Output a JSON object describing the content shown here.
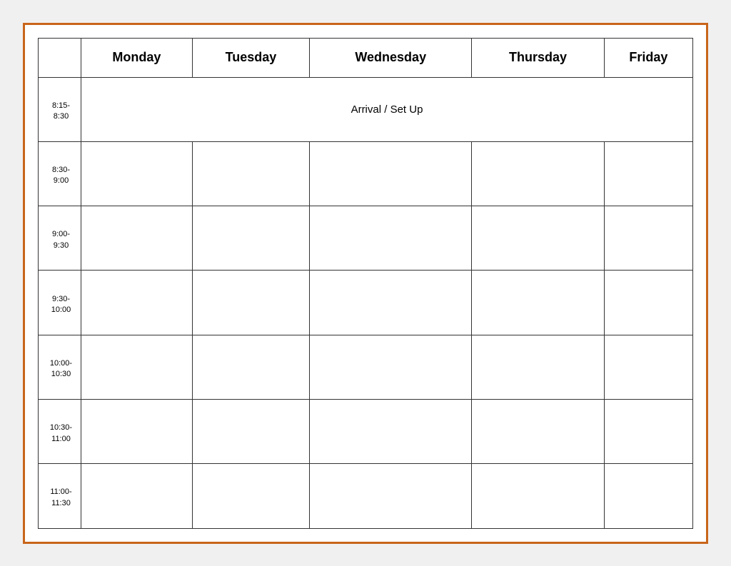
{
  "table": {
    "headers": {
      "time": "",
      "monday": "Monday",
      "tuesday": "Tuesday",
      "wednesday": "Wednesday",
      "thursday": "Thursday",
      "friday": "Friday"
    },
    "rows": [
      {
        "time": "8:15-\n8:30",
        "arrival": "Arrival / Set Up",
        "span": 5
      },
      {
        "time": "8:30-\n9:00"
      },
      {
        "time": "9:00-\n9:30"
      },
      {
        "time": "9:30-\n10:00"
      },
      {
        "time": "10:00-\n10:30"
      },
      {
        "time": "10:30-\n11:00"
      },
      {
        "time": "11:00-\n11:30"
      }
    ]
  }
}
